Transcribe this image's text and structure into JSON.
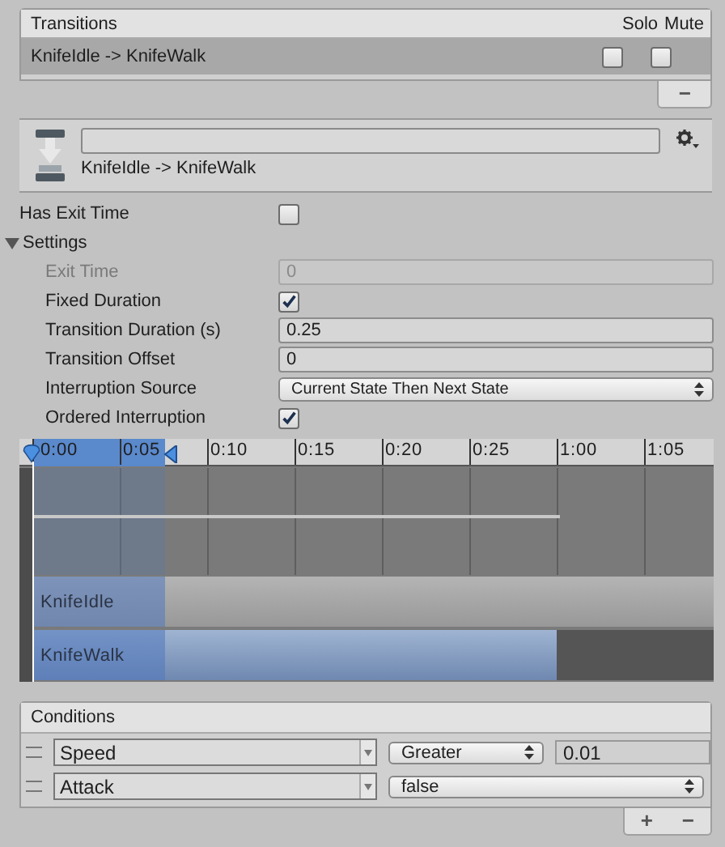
{
  "transitions": {
    "title": "Transitions",
    "solo_label": "Solo",
    "mute_label": "Mute",
    "items": [
      {
        "name": "KnifeIdle -> KnifeWalk",
        "selected": true,
        "solo": false,
        "mute": false
      }
    ],
    "remove_label": "−"
  },
  "header": {
    "subtitle": "KnifeIdle -> KnifeWalk"
  },
  "has_exit_time": {
    "label": "Has Exit Time",
    "checked": false
  },
  "settings": {
    "label": "Settings",
    "expanded": true,
    "rows": [
      {
        "kind": "number",
        "label": "Exit Time",
        "value": "0",
        "disabled": true
      },
      {
        "kind": "checkbox",
        "label": "Fixed Duration",
        "checked": true
      },
      {
        "kind": "number",
        "label": "Transition Duration (s)",
        "value": "0.25",
        "disabled": false
      },
      {
        "kind": "number",
        "label": "Transition Offset",
        "value": "0",
        "disabled": false
      },
      {
        "kind": "dropdown",
        "label": "Interruption Source",
        "value": "Current State Then Next State"
      },
      {
        "kind": "checkbox",
        "label": "Ordered Interruption",
        "checked": true
      }
    ]
  },
  "timeline": {
    "ticks": [
      "0:00",
      "0:05",
      "0:10",
      "0:15",
      "0:20",
      "0:25",
      "1:00",
      "1:05"
    ],
    "tracks": [
      {
        "name": "KnifeIdle"
      },
      {
        "name": "KnifeWalk"
      }
    ]
  },
  "conditions": {
    "title": "Conditions",
    "items": [
      {
        "parameter": "Speed",
        "mode": "Greater",
        "value": "0.01"
      },
      {
        "parameter": "Attack",
        "mode": "false"
      }
    ],
    "add_label": "+",
    "remove_label": "−"
  }
}
